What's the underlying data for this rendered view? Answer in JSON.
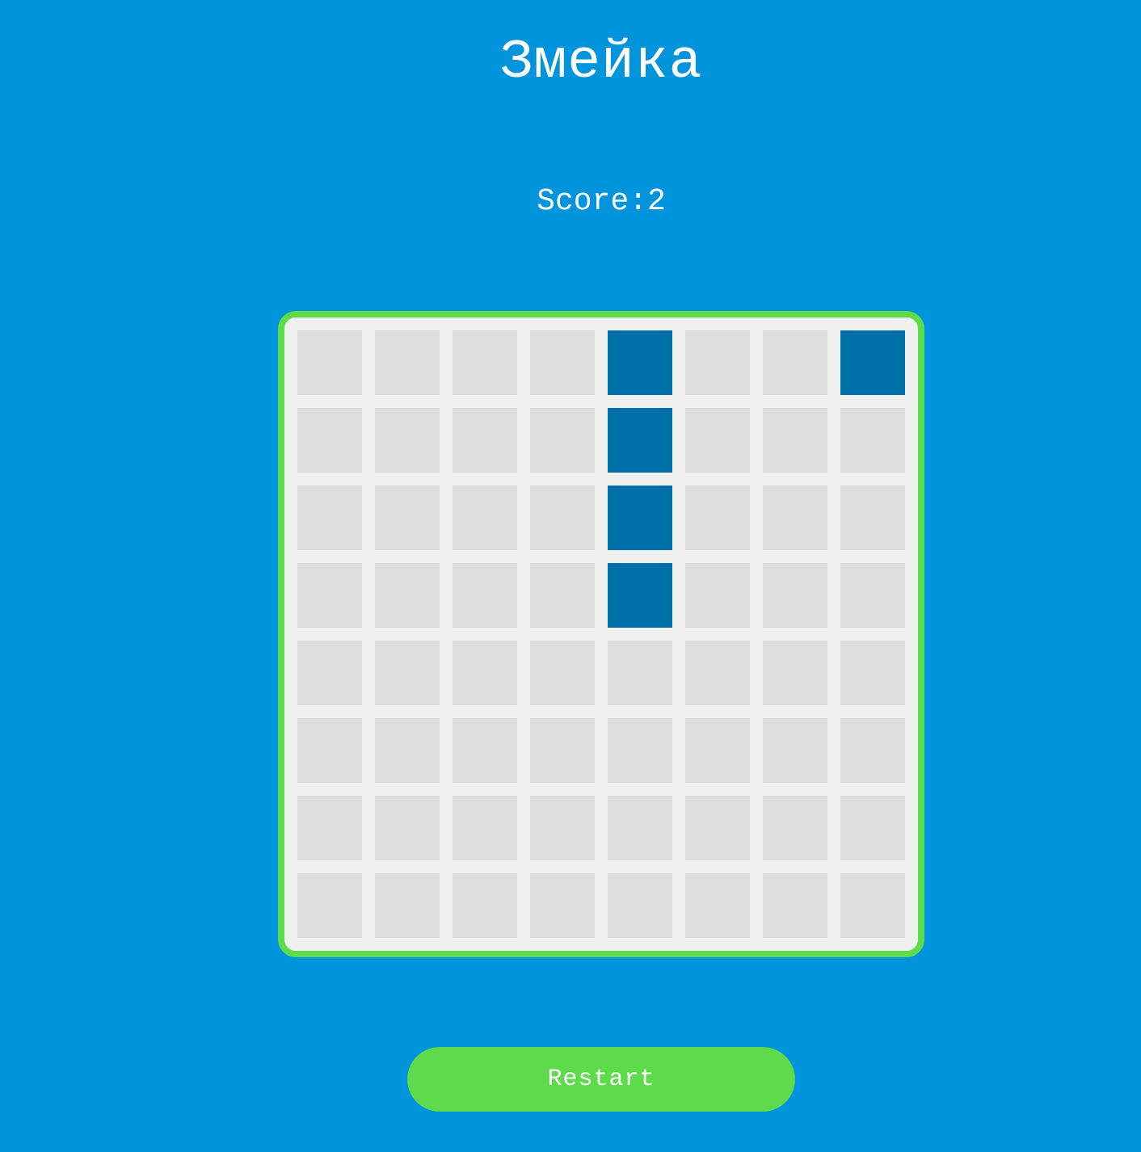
{
  "title": "Змейка",
  "score_text": "Score:2",
  "restart_label": "Restart",
  "colors": {
    "background": "#0094dc",
    "board_border": "#5ddb4a",
    "board_bg": "#f0f0f0",
    "empty_cell": "#dddddd",
    "snake_cell": "#0070aa",
    "button": "#5ddb4a"
  },
  "board": {
    "rows": 8,
    "cols": 8,
    "filled_cells": [
      [
        0,
        4
      ],
      [
        1,
        4
      ],
      [
        2,
        4
      ],
      [
        3,
        4
      ],
      [
        0,
        7
      ]
    ]
  }
}
